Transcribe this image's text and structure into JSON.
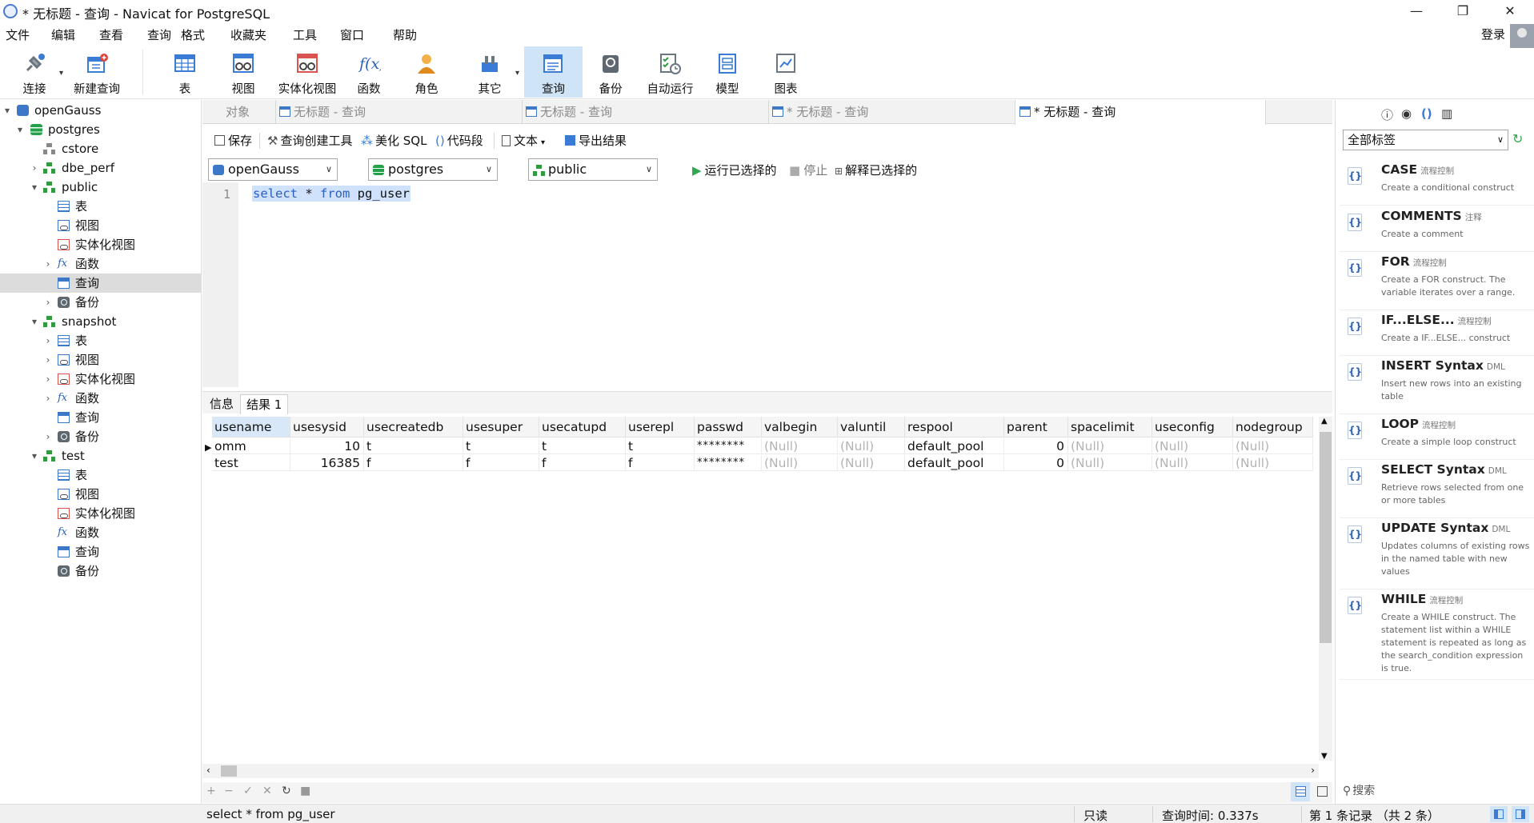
{
  "window": {
    "title": "* 无标题 - 查询 - Navicat for PostgreSQL",
    "minimize": "—",
    "maximize": "❐",
    "close": "✕"
  },
  "menu": [
    "文件",
    "编辑",
    "查看",
    "查询",
    "格式",
    "收藏夹",
    "工具",
    "窗口",
    "帮助"
  ],
  "account": {
    "login": "登录"
  },
  "toolbar": [
    {
      "label": "连接",
      "icon": "plug-icon"
    },
    {
      "label": "新建查询",
      "icon": "new-query-icon"
    },
    {
      "label": "表",
      "icon": "table-icon"
    },
    {
      "label": "视图",
      "icon": "view-icon"
    },
    {
      "label": "实体化视图",
      "icon": "materialized-view-icon"
    },
    {
      "label": "函数",
      "icon": "function-icon"
    },
    {
      "label": "角色",
      "icon": "role-icon"
    },
    {
      "label": "其它",
      "icon": "other-icon"
    },
    {
      "label": "查询",
      "icon": "query-icon",
      "active": true
    },
    {
      "label": "备份",
      "icon": "backup-icon"
    },
    {
      "label": "自动运行",
      "icon": "automation-icon"
    },
    {
      "label": "模型",
      "icon": "model-icon"
    },
    {
      "label": "图表",
      "icon": "chart-icon"
    }
  ],
  "tree": [
    {
      "label": "openGauss",
      "icon": "server-icon"
    },
    {
      "label": "postgres",
      "icon": "database-icon"
    },
    {
      "label": "cstore",
      "icon": "schema-icon"
    },
    {
      "label": "dbe_perf",
      "icon": "schema-icon"
    },
    {
      "label": "public",
      "icon": "schema-icon"
    },
    {
      "label": "表",
      "icon": "table-icon"
    },
    {
      "label": "视图",
      "icon": "view-icon"
    },
    {
      "label": "实体化视图",
      "icon": "materialized-view-icon"
    },
    {
      "label": "函数",
      "icon": "function-icon"
    },
    {
      "label": "查询",
      "icon": "query-icon",
      "selected": true
    },
    {
      "label": "备份",
      "icon": "backup-icon"
    },
    {
      "label": "snapshot",
      "icon": "schema-icon"
    },
    {
      "label": "表",
      "icon": "table-icon"
    },
    {
      "label": "视图",
      "icon": "view-icon"
    },
    {
      "label": "实体化视图",
      "icon": "materialized-view-icon"
    },
    {
      "label": "函数",
      "icon": "function-icon"
    },
    {
      "label": "查询",
      "icon": "query-icon"
    },
    {
      "label": "备份",
      "icon": "backup-icon"
    },
    {
      "label": "test",
      "icon": "schema-icon"
    },
    {
      "label": "表",
      "icon": "table-icon"
    },
    {
      "label": "视图",
      "icon": "view-icon"
    },
    {
      "label": "实体化视图",
      "icon": "materialized-view-icon"
    },
    {
      "label": "函数",
      "icon": "function-icon"
    },
    {
      "label": "查询",
      "icon": "query-icon"
    },
    {
      "label": "备份",
      "icon": "backup-icon"
    }
  ],
  "tabs": {
    "objects": "对象",
    "items": [
      {
        "label": "无标题 - 查询"
      },
      {
        "label": "无标题 - 查询"
      },
      {
        "label": "* 无标题 - 查询"
      },
      {
        "label": "* 无标题 - 查询",
        "active": true
      }
    ]
  },
  "query_toolbar": {
    "save": "保存",
    "builder": "查询创建工具",
    "beautify": "美化 SQL",
    "snippet": "代码段",
    "text": "文本",
    "export": "导出结果"
  },
  "selectors": {
    "connection": "openGauss",
    "database": "postgres",
    "schema": "public",
    "run_selected": "运行已选择的",
    "stop": "停止",
    "explain_selected": "解释已选择的"
  },
  "editor": {
    "line_number": "1",
    "kw1": "select",
    "star": " * ",
    "kw2": "from",
    "table": " pg_user"
  },
  "results": {
    "tabs": [
      "信息",
      "结果 1"
    ],
    "columns": [
      "usename",
      "usesysid",
      "usecreatedb",
      "usesuper",
      "usecatupd",
      "userepl",
      "passwd",
      "valbegin",
      "valuntil",
      "respool",
      "parent",
      "spacelimit",
      "useconfig",
      "nodegroup"
    ],
    "rows": [
      [
        "omm",
        "10",
        "t",
        "t",
        "t",
        "t",
        "********",
        "(Null)",
        "(Null)",
        "default_pool",
        "0",
        "(Null)",
        "(Null)",
        "(Null)"
      ],
      [
        "test",
        "16385",
        "f",
        "f",
        "f",
        "f",
        "********",
        "(Null)",
        "(Null)",
        "default_pool",
        "0",
        "(Null)",
        "(Null)",
        "(Null)"
      ]
    ]
  },
  "nav": {
    "add": "+",
    "remove": "−",
    "apply": "✓",
    "cancel": "✕",
    "refresh": "↻",
    "stop": "■"
  },
  "snippets_panel": {
    "filter": "全部标签",
    "items": [
      {
        "name": "CASE",
        "tag": "流程控制",
        "desc": "Create a conditional construct"
      },
      {
        "name": "COMMENTS",
        "tag": "注释",
        "desc": "Create a comment"
      },
      {
        "name": "FOR",
        "tag": "流程控制",
        "desc": "Create a FOR construct. The variable iterates over a range."
      },
      {
        "name": "IF...ELSE...",
        "tag": "流程控制",
        "desc": "Create a IF...ELSE... construct"
      },
      {
        "name": "INSERT Syntax",
        "tag": "DML",
        "desc": "Insert new rows into an existing table"
      },
      {
        "name": "LOOP",
        "tag": "流程控制",
        "desc": "Create a simple loop construct"
      },
      {
        "name": "SELECT Syntax",
        "tag": "DML",
        "desc": "Retrieve rows selected from one or more tables"
      },
      {
        "name": "UPDATE Syntax",
        "tag": "DML",
        "desc": "Updates columns of existing rows in the named table with new values"
      },
      {
        "name": "WHILE",
        "tag": "流程控制",
        "desc": "Create a WHILE construct. The statement list within a WHILE statement is repeated as long as the search_condition expression is true."
      }
    ],
    "search_placeholder": "搜索"
  },
  "status": {
    "sql": "select * from pg_user",
    "readonly": "只读",
    "query_time": "查询时间: 0.337s",
    "records": "第 1 条记录 （共 2 条）"
  }
}
